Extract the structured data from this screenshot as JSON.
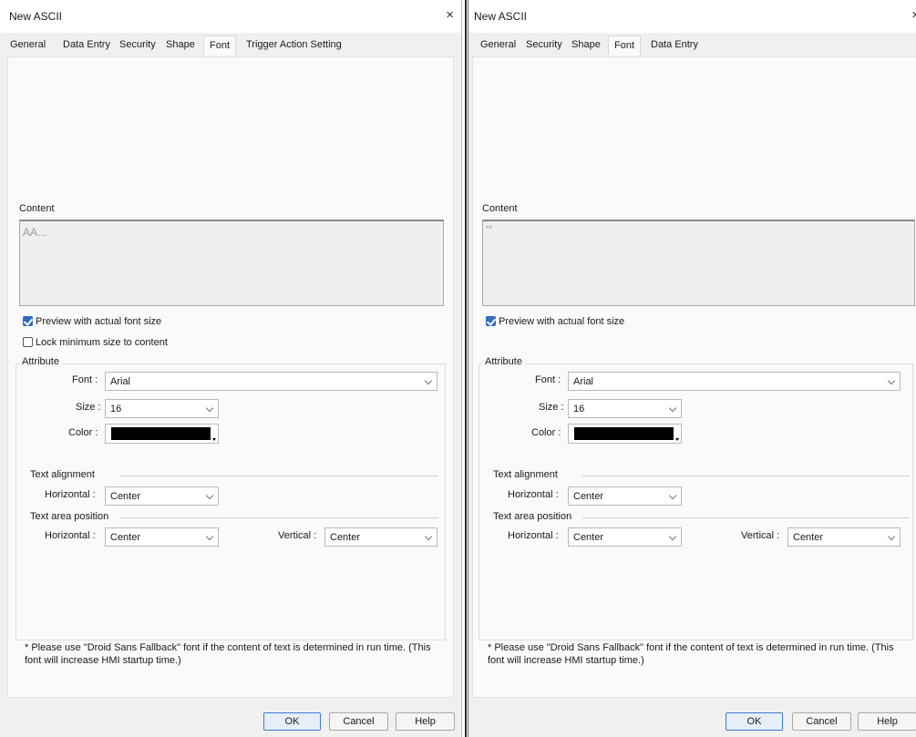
{
  "left": {
    "title": "New ASCII",
    "close_glyph": "×",
    "tabs": [
      "General",
      "Data Entry",
      "Security",
      "Shape",
      "Font",
      "Trigger Action Setting"
    ],
    "active_tab": "Font",
    "content_label": "Content",
    "content_text": "AA...",
    "preview_checkbox": {
      "label": "Preview with actual font size",
      "checked": true
    },
    "lock_checkbox": {
      "label": "Lock minimum size to content",
      "checked": false
    },
    "attribute_label": "Attribute",
    "font_label": "Font :",
    "font_value": "Arial",
    "size_label": "Size :",
    "size_value": "16",
    "color_label": "Color :",
    "color_value": "#000000",
    "text_alignment_label": "Text alignment",
    "align_horizontal_label": "Horizontal :",
    "align_horizontal_value": "Center",
    "text_area_position_label": "Text area position",
    "area_horizontal_label": "Horizontal :",
    "area_horizontal_value": "Center",
    "area_vertical_label": "Vertical :",
    "area_vertical_value": "Center",
    "note": "* Please use \"Droid Sans Fallback\" font if the content of text is determined in run time. (This font will increase HMI startup time.)",
    "buttons": {
      "ok": "OK",
      "cancel": "Cancel",
      "help": "Help"
    }
  },
  "right": {
    "title": "New ASCII",
    "close_glyph": "×",
    "tabs": [
      "General",
      "Security",
      "Shape",
      "Font",
      "Data Entry"
    ],
    "active_tab": "Font",
    "content_label": "Content",
    "content_text": "**",
    "preview_checkbox": {
      "label": "Preview with actual font size",
      "checked": true
    },
    "attribute_label": "Attribute",
    "font_label": "Font :",
    "font_value": "Arial",
    "size_label": "Size :",
    "size_value": "16",
    "color_label": "Color :",
    "color_value": "#000000",
    "text_alignment_label": "Text alignment",
    "align_horizontal_label": "Horizontal :",
    "align_horizontal_value": "Center",
    "text_area_position_label": "Text area position",
    "area_horizontal_label": "Horizontal :",
    "area_horizontal_value": "Center",
    "area_vertical_label": "Vertical :",
    "area_vertical_value": "Center",
    "note": "* Please use \"Droid Sans Fallback\" font if the content of text is determined in run time. (This font will increase HMI startup time.)",
    "buttons": {
      "ok": "OK",
      "cancel": "Cancel",
      "help": "Help"
    }
  }
}
